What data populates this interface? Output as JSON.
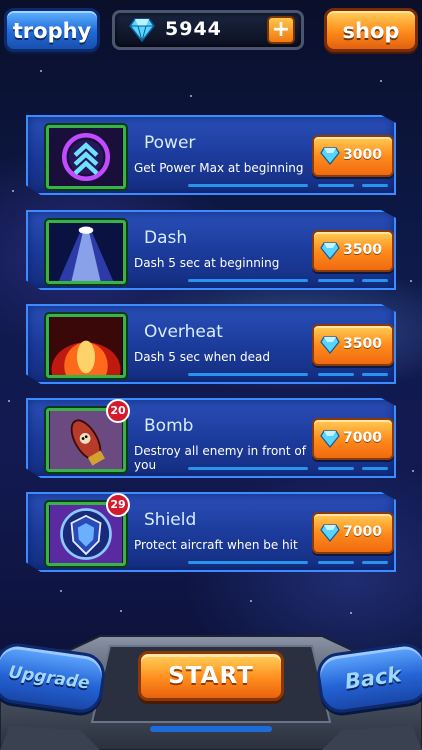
{
  "header": {
    "trophy_label": "trophy",
    "gem_count": "5944",
    "plus_label": "+",
    "shop_label": "shop"
  },
  "items": [
    {
      "title": "Power",
      "description": "Get Power Max at beginning",
      "price": "3000",
      "badge": null,
      "icon": "chevron-up-icon"
    },
    {
      "title": "Dash",
      "description": "Dash 5 sec at beginning",
      "price": "3500",
      "badge": null,
      "icon": "light-beam-icon"
    },
    {
      "title": "Overheat",
      "description": "Dash 5 sec when dead",
      "price": "3500",
      "badge": null,
      "icon": "fire-burst-icon"
    },
    {
      "title": "Bomb",
      "description": "Destroy all enemy in front of you",
      "price": "7000",
      "badge": "20",
      "icon": "bomb-icon"
    },
    {
      "title": "Shield",
      "description": "Protect aircraft when be hit",
      "price": "7000",
      "badge": "29",
      "icon": "shield-icon"
    }
  ],
  "footer": {
    "upgrade_label": "Upgrade",
    "start_label": "START",
    "back_label": "Back"
  },
  "colors": {
    "accent_blue": "#2a4fb8",
    "accent_orange": "#ff8c1c",
    "frame_green": "#39b24a",
    "badge_red": "#d41a2c",
    "gem_cyan": "#5fe0ff"
  }
}
